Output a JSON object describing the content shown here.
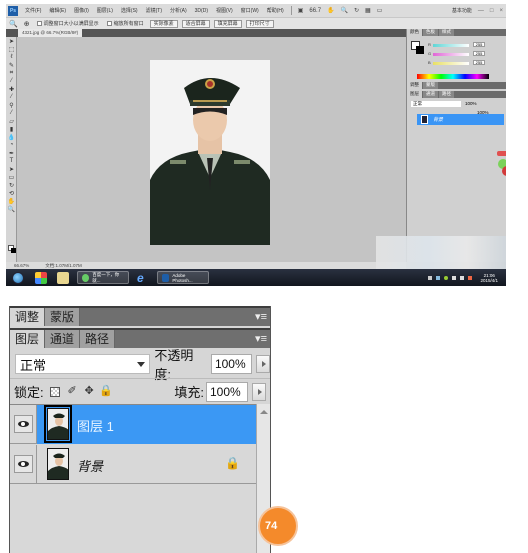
{
  "photoshop_window": {
    "app_logo": "Ps",
    "menu": [
      "文件(F)",
      "编辑(E)",
      "图像(I)",
      "图层(L)",
      "选择(S)",
      "滤镜(T)",
      "分析(A)",
      "3D(D)",
      "视图(V)",
      "窗口(W)",
      "帮助(H)"
    ],
    "zoom_level_menu": "66.7",
    "workspace": "基本功能",
    "window_controls": [
      "—",
      "□",
      "×"
    ],
    "options_bar": {
      "checkbox_resize_windows": "调整窗口大小以满屏显示",
      "checkbox_zoom_all": "缩放所有窗口",
      "buttons": [
        "实际像素",
        "适合屏幕",
        "填充屏幕",
        "打印尺寸"
      ]
    },
    "document_tab": "4321.jpg @ 66.7%(RGB/8#)",
    "status": {
      "zoom": "66.67%",
      "doc_size": "文档:1.07M/1.07M"
    },
    "color_panel": {
      "tabs": [
        "颜色",
        "色板",
        "样式"
      ],
      "channels": [
        {
          "label": "R",
          "value": "255",
          "color": "#5fd6d6"
        },
        {
          "label": "G",
          "value": "255",
          "color": "#e066d6"
        },
        {
          "label": "B",
          "value": "255",
          "color": "#e8e066"
        }
      ]
    },
    "mini_layers": {
      "adjust_tabs": [
        "调整",
        "蒙版"
      ],
      "tabs": [
        "图层",
        "通道",
        "路径"
      ],
      "blend": "正常",
      "opacity": "100%",
      "fill": "100%",
      "layer_name": "背景"
    },
    "taskbar": {
      "tasks": [
        "百度一下，你就...",
        "Adobe Photosh..."
      ],
      "clock_time": "21:06",
      "clock_date": "2015/4/1"
    }
  },
  "layers_panel": {
    "adjust_tabs": [
      "调整",
      "蒙版"
    ],
    "tabs": [
      "图层",
      "通道",
      "路径"
    ],
    "blend_mode": "正常",
    "opacity_label": "不透明度:",
    "opacity_value": "100%",
    "lock_label": "锁定:",
    "fill_label": "填充:",
    "fill_value": "100%",
    "layers": [
      {
        "name": "图层 1",
        "selected": true,
        "visible": true,
        "locked": false
      },
      {
        "name": "背景",
        "selected": false,
        "visible": true,
        "locked": true
      }
    ],
    "accent_color": "#3b98f4"
  },
  "badge": {
    "text": "74",
    "color": "#f48a2b"
  }
}
